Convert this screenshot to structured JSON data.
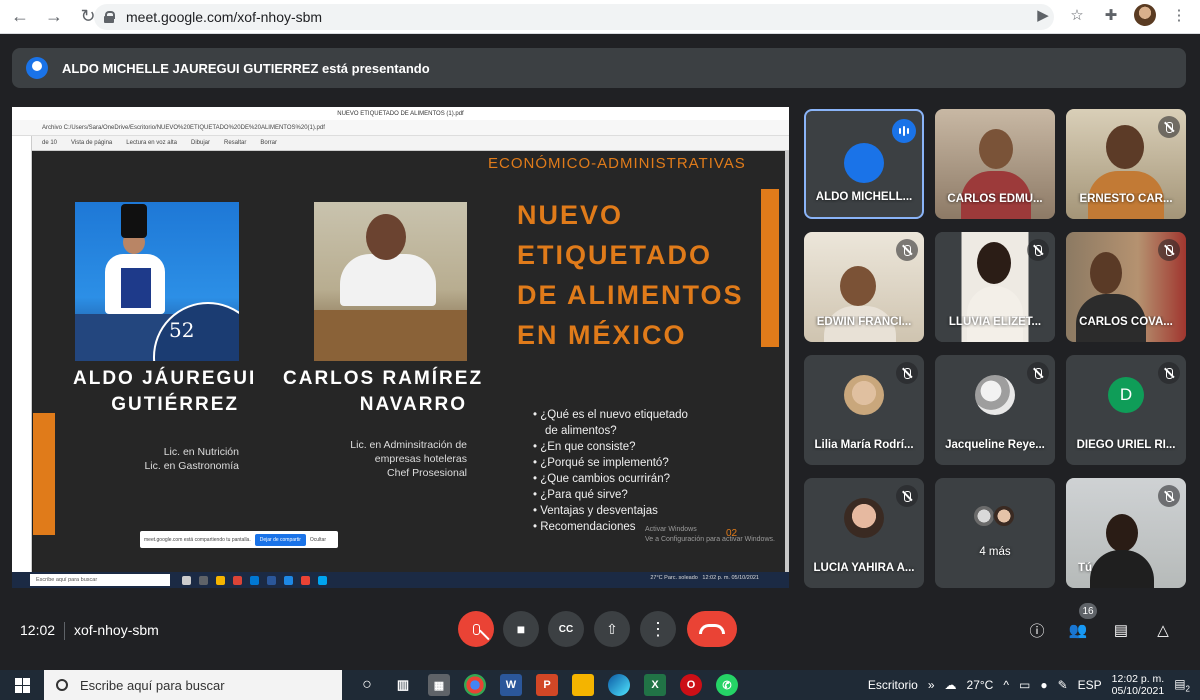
{
  "browser": {
    "url": "meet.google.com/xof-nhoy-sbm"
  },
  "banner": {
    "text": "ALDO MICHELLE JAUREGUI GUTIERREZ está presentando"
  },
  "shared_screen": {
    "window_title": "NUEVO ETIQUETADO DE ALIMENTOS (1).pdf",
    "address": "Archivo  C:/Users/Sara/OneDrive/Escritorio/NUEVO%20ETIQUETADO%20DE%20ALIMENTOS%20(1).pdf",
    "toolbar": [
      "de 10",
      "Vista de página",
      "Lectura en voz alta",
      "Dibujar",
      "Resaltar",
      "Borrar"
    ],
    "slide": {
      "top_text": "ECONÓMICO-ADMINISTRATIVAS",
      "title_lines": [
        "NUEVO",
        "ETIQUETADO",
        "DE ALIMENTOS",
        "EN MÉXICO"
      ],
      "photo1_badge": "52",
      "person1": {
        "name_lines": [
          "ALDO JÁUREGUI",
          "GUTIÉRREZ"
        ],
        "details": [
          "Lic. en Nutrición",
          "Lic. en Gastronomía"
        ]
      },
      "person2": {
        "name_lines": [
          "CARLOS RAMÍREZ",
          "NAVARRO"
        ],
        "details": [
          "Lic. en Adminsitración de",
          "empresas hoteleras",
          "Chef Prosesional"
        ]
      },
      "bullets": [
        "¿Qué es el nuevo etiquetado",
        "de alimentos?",
        "¿En que consiste?",
        "¿Porqué se implementó?",
        "¿Que cambios ocurrirán?",
        "¿Para qué sirve?",
        "Ventajas y desventajas",
        "Recomendaciones"
      ],
      "page_number": "02",
      "activate_windows": [
        "Activar Windows",
        "Ve a Configuración para activar Windows."
      ]
    },
    "share_notice": {
      "text": "meet.google.com está compartiendo tu pantalla.",
      "stop": "Dejar de compartir",
      "hide": "Ocultar"
    },
    "taskbar": {
      "search": "Escribe aquí para buscar",
      "weather": "27°C  Parc. soleado",
      "time": "12:02 p. m.",
      "date": "05/10/2021"
    }
  },
  "participants": [
    {
      "name": "ALDO MICHELL...",
      "mic": "speaking",
      "kind": "avatar"
    },
    {
      "name": "CARLOS EDMU...",
      "mic": "none",
      "kind": "camera"
    },
    {
      "name": "ERNESTO CAR...",
      "mic": "muted",
      "kind": "camera"
    },
    {
      "name": "EDWIN FRANCI...",
      "mic": "muted",
      "kind": "camera"
    },
    {
      "name": "LLUVIA ELIZET...",
      "mic": "muted",
      "kind": "camera"
    },
    {
      "name": "CARLOS COVA...",
      "mic": "muted",
      "kind": "camera"
    },
    {
      "name": "Lilia María Rodrí...",
      "mic": "muted",
      "kind": "avatar"
    },
    {
      "name": "Jacqueline Reye...",
      "mic": "muted",
      "kind": "avatar"
    },
    {
      "name": "DIEGO URIEL RI...",
      "mic": "muted",
      "kind": "letter",
      "initial": "D"
    },
    {
      "name": "LUCIA YAHIRA A...",
      "mic": "muted",
      "kind": "avatar"
    },
    {
      "name": "4 más",
      "mic": "none",
      "kind": "more"
    },
    {
      "name": "Tú",
      "mic": "muted",
      "kind": "camera"
    }
  ],
  "bottom_bar": {
    "time": "12:02",
    "meeting_code": "xof-nhoy-sbm",
    "participants_count": "16"
  },
  "windows_taskbar": {
    "search": "Escribe aquí para buscar",
    "desktop": "Escritorio",
    "weather": "27°C",
    "lang": "ESP",
    "time": "12:02 p. m.",
    "date": "05/10/2021",
    "notifications": "2"
  },
  "colors": {
    "accent_orange": "#e07b1a",
    "meet_red": "#ea4335",
    "meet_blue": "#1a73e8",
    "tile_bg": "#3c4043"
  }
}
